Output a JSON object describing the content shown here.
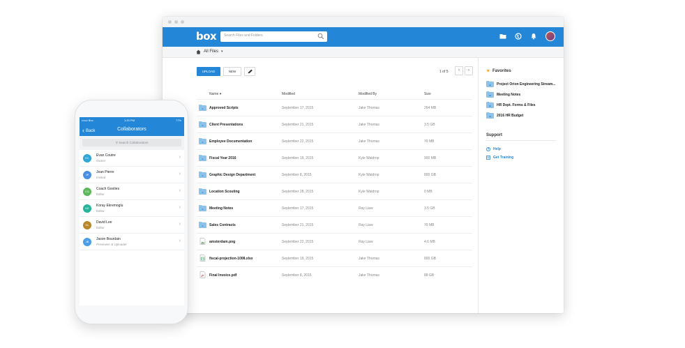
{
  "desktop": {
    "logo": "box",
    "search_placeholder": "Search Files and Folders",
    "breadcrumb": "All Files",
    "toolbar": {
      "upload": "UPLOAD",
      "new": "NEW"
    },
    "pager": {
      "text": "1 of 5",
      "prev": "‹",
      "next": "›"
    },
    "columns": {
      "name": "Name ▾",
      "modified": "Modified",
      "modified_by": "Modified By",
      "size": "Size"
    },
    "files": [
      {
        "name": "Approved Scripts",
        "modified": "September 17, 2015",
        "by": "Jake Thomas",
        "size": "264 MB",
        "icon": "folder-icon"
      },
      {
        "name": "Client Presentations",
        "modified": "September 21, 2015",
        "by": "Jake Thomas",
        "size": "3.5 GB",
        "icon": "folder-icon"
      },
      {
        "name": "Employee Documentation",
        "modified": "September 22, 2015",
        "by": "Jake Thomas",
        "size": "79 MB",
        "icon": "folder-icon"
      },
      {
        "name": "Fiscal Year 2016",
        "modified": "September 19, 2015",
        "by": "Kyle Waldrop",
        "size": "900 MB",
        "icon": "folder-icon"
      },
      {
        "name": "Graphic Design Department",
        "modified": "September 8, 2015",
        "by": "Kyle Waldrop",
        "size": "800 GB",
        "icon": "folder-icon"
      },
      {
        "name": "Location Scouting",
        "modified": "September 28, 2015",
        "by": "Kyle Waldrop",
        "size": "0 MB",
        "icon": "folder-icon"
      },
      {
        "name": "Meeting Notes",
        "modified": "September 17, 2015",
        "by": "Ray Liaw",
        "size": "3.5 GB",
        "icon": "folder-icon"
      },
      {
        "name": "Sales Contracts",
        "modified": "September 21, 2015",
        "by": "Ray Liaw",
        "size": "79 MB",
        "icon": "folder-icon"
      },
      {
        "name": "amsterdam.png",
        "modified": "September 22, 2015",
        "by": "Ray Liaw",
        "size": "4.6 MB",
        "icon": "image-file-icon"
      },
      {
        "name": "fiscal-projection-1008.xlsx",
        "modified": "September 19, 2015",
        "by": "Jake Thomas",
        "size": "800 GB",
        "icon": "spreadsheet-file-icon"
      },
      {
        "name": "Final Invoice.pdf",
        "modified": "September 8, 2015",
        "by": "Jake Thomas",
        "size": "88 GB",
        "icon": "pdf-file-icon"
      }
    ],
    "favorites_title": "Favorites",
    "favorites": [
      "Project Orion Engineering Stream...",
      "Meeting Notes",
      "HR Dept. Forms & Files",
      "2016 HR Budget"
    ],
    "support_title": "Support",
    "support_links": [
      "Help",
      "Get Training"
    ],
    "colors": {
      "brand": "#2486d6",
      "star": "#f5a623"
    }
  },
  "mobile": {
    "status": {
      "carrier": "•••oo Box",
      "time": "1:20 PM",
      "battery": "77%"
    },
    "back": "Back",
    "title": "Collaborators",
    "search_placeholder": "Search Collaborators",
    "collaborators": [
      {
        "initials": "EC",
        "name": "Evan Coutre",
        "role": "Owner",
        "color": "#2fa6d8"
      },
      {
        "initials": "JP",
        "name": "Jean Pierre",
        "role": "Invited",
        "color": "#4a90e2"
      },
      {
        "initials": "CG",
        "name": "Coach Gooties",
        "role": "Editor",
        "color": "#5cb85c"
      },
      {
        "initials": "KE",
        "name": "Koray Ekremoglu",
        "role": "Editor",
        "color": "#26b59a"
      },
      {
        "initials": "DL",
        "name": "David Lee",
        "role": "Editor",
        "color": "#b8862b"
      },
      {
        "initials": "JB",
        "name": "Jason Bourdain",
        "role": "Previewer & Uploader",
        "color": "#4a9fe8"
      }
    ]
  }
}
